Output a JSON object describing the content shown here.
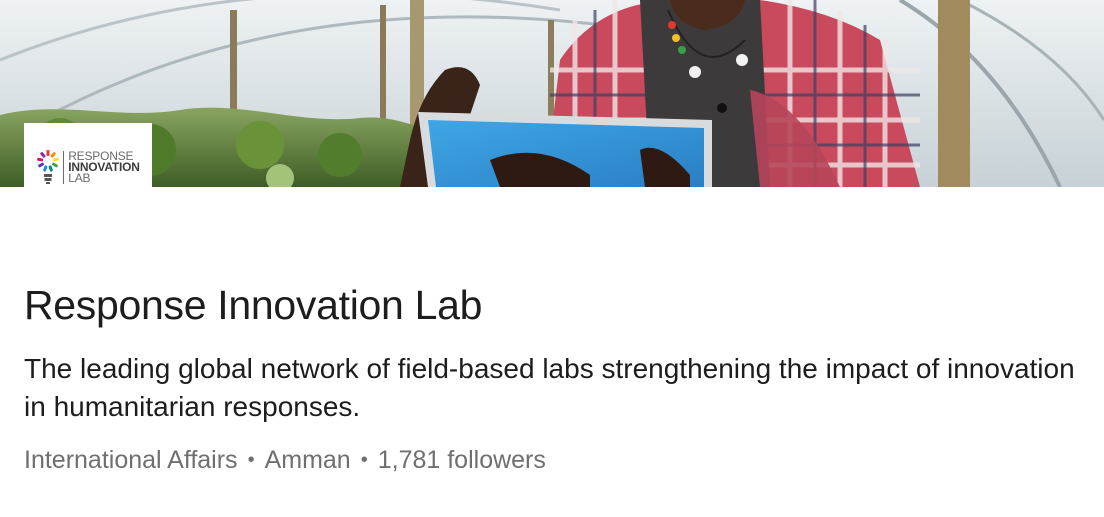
{
  "cover": {
    "image_description_icon": "greenhouse-farmer-tablet-image"
  },
  "logo": {
    "line1": "RESPONSE",
    "line2": "INNOVATION",
    "line3": "LAB",
    "icon": "lightbulb-icon"
  },
  "company": {
    "name": "Response Innovation Lab",
    "tagline": "The leading global network of field-based labs strengthening the impact of innovation in humanitarian responses.",
    "industry": "International Affairs",
    "location": "Amman",
    "followers": "1,781 followers",
    "separator": "•"
  },
  "colors": {
    "title_text": "#1d1d1d",
    "meta_text": "#6f6f6f",
    "background": "#ffffff"
  }
}
